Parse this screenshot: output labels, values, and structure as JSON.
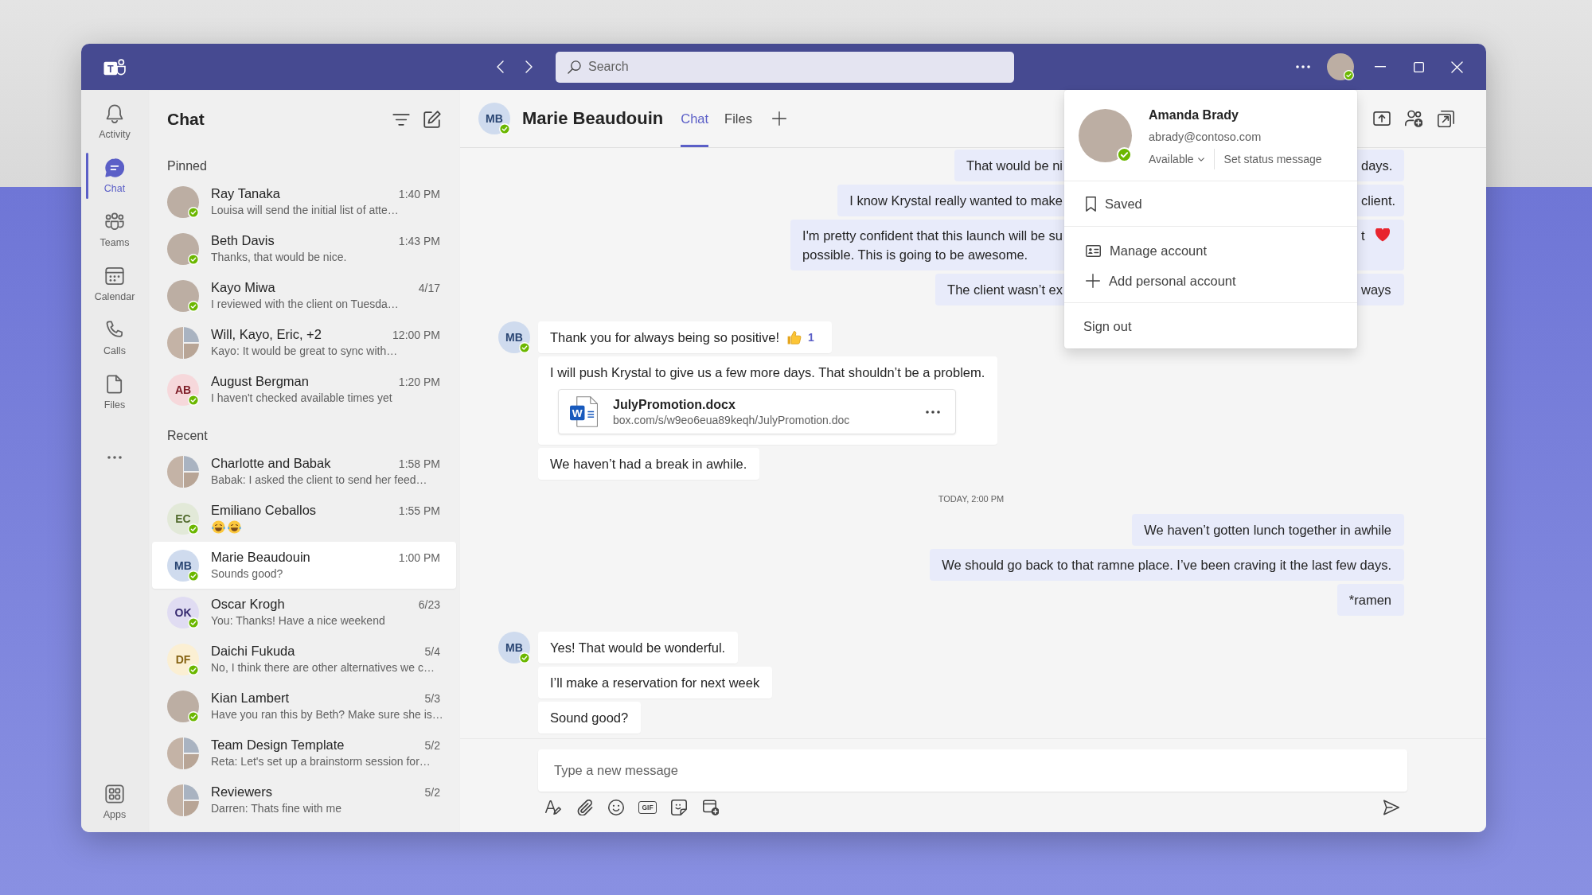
{
  "title_bar": {
    "logo_letter": "T",
    "search": {
      "placeholder": "Search"
    },
    "profile": {
      "avatar": {
        "kind": "photo"
      },
      "available": true
    }
  },
  "rail": {
    "items": [
      {
        "label": "Activity",
        "selected": false
      },
      {
        "label": "Chat",
        "selected": true
      },
      {
        "label": "Teams",
        "selected": false
      },
      {
        "label": "Calendar",
        "selected": false
      },
      {
        "label": "Calls",
        "selected": false
      },
      {
        "label": "Files",
        "selected": false
      }
    ],
    "bottom_items": [
      {
        "label": "Apps",
        "selected": false
      }
    ]
  },
  "chat_list": {
    "title": "Chat",
    "sections": [
      {
        "label": "Pinned",
        "chats": [
          {
            "name": "Ray Tanaka",
            "time": "1:40 PM",
            "kind": "text",
            "preview": "Louisa will send the initial list of atte…",
            "avatar": {
              "kind": "photo"
            },
            "available": true,
            "selected": false
          },
          {
            "name": "Beth Davis",
            "time": "1:43 PM",
            "kind": "text",
            "preview": "Thanks, that would be nice.",
            "avatar": {
              "kind": "photo"
            },
            "available": true,
            "selected": false
          },
          {
            "name": "Kayo Miwa",
            "time": "4/17",
            "kind": "text",
            "preview": "I reviewed with the client on Tuesda…",
            "avatar": {
              "kind": "photo"
            },
            "available": true,
            "selected": false
          },
          {
            "name": "Will, Kayo, Eric, +2",
            "time": "12:00 PM",
            "kind": "text",
            "preview": "Kayo: It would be great to sync with…",
            "avatar": {
              "kind": "group"
            },
            "available": false,
            "selected": false
          },
          {
            "name": "August Bergman",
            "time": "1:20 PM",
            "kind": "text",
            "preview": "I haven't checked available times yet",
            "avatar": {
              "kind": "initials",
              "initials": "AB",
              "color": "#f6d8db"
            },
            "available": true,
            "selected": false
          }
        ]
      },
      {
        "label": "Recent",
        "chats": [
          {
            "name": "Charlotte and Babak",
            "time": "1:58 PM",
            "kind": "text",
            "preview": "Babak: I asked the client to send her feed…",
            "avatar": {
              "kind": "group"
            },
            "available": false,
            "selected": false
          },
          {
            "name": "Emiliano Ceballos",
            "time": "1:55 PM",
            "kind": "emoji",
            "avatar": {
              "kind": "initials",
              "initials": "EC",
              "color": "#e2e9d8"
            },
            "available": true,
            "selected": false
          },
          {
            "name": "Marie Beaudouin",
            "time": "1:00 PM",
            "kind": "text",
            "preview": "Sounds good?",
            "avatar": {
              "kind": "initials",
              "initials": "MB",
              "color": "#cfdbee"
            },
            "available": true,
            "selected": true
          },
          {
            "name": "Oscar Krogh",
            "time": "6/23",
            "kind": "text",
            "preview": "You: Thanks! Have a nice weekend",
            "avatar": {
              "kind": "initials",
              "initials": "OK",
              "color": "#e0dcf2"
            },
            "available": true,
            "selected": false
          },
          {
            "name": "Daichi Fukuda",
            "time": "5/4",
            "kind": "text",
            "preview": "No, I think there are other alternatives we c…",
            "avatar": {
              "kind": "initials",
              "initials": "DF",
              "color": "#fbefd3"
            },
            "available": true,
            "selected": false
          },
          {
            "name": "Kian Lambert",
            "time": "5/3",
            "kind": "text",
            "preview": "Have you ran this by Beth? Make sure she is…",
            "avatar": {
              "kind": "photo"
            },
            "available": true,
            "selected": false
          },
          {
            "name": "Team Design Template",
            "time": "5/2",
            "kind": "text",
            "preview": "Reta: Let's set up a brainstorm session for…",
            "avatar": {
              "kind": "group"
            },
            "available": false,
            "selected": false
          },
          {
            "name": "Reviewers",
            "time": "5/2",
            "kind": "text",
            "preview": "Darren: Thats fine with me",
            "avatar": {
              "kind": "group"
            },
            "available": false,
            "selected": false
          }
        ]
      }
    ]
  },
  "conversation": {
    "header": {
      "avatar": {
        "kind": "initials",
        "initials": "MB",
        "color": "#cfdbee"
      },
      "available": true,
      "name": "Marie Beaudouin",
      "tabs": [
        {
          "label": "Chat",
          "selected": true
        },
        {
          "label": "Files",
          "selected": false
        }
      ]
    },
    "messages": [
      {
        "kind": "outgoing",
        "bubbles": [
          {
            "kind": "split",
            "left_lines": [
              "That would be ni"
            ],
            "right_text": "days."
          },
          {
            "kind": "split",
            "left_lines": [
              "I know Krystal really wanted to make"
            ],
            "right_text": "client."
          },
          {
            "kind": "split",
            "left_lines": [
              "I'm pretty confident that this launch will be su",
              "possible. This is going to be awesome."
            ],
            "right_text": "t",
            "reaction": {
              "kind": "heart"
            }
          },
          {
            "kind": "split",
            "left_lines": [
              "The client wasn’t ex"
            ],
            "right_text": "ways"
          }
        ]
      },
      {
        "kind": "incoming",
        "avatar": {
          "kind": "initials",
          "initials": "MB",
          "color": "#cfdbee"
        },
        "available": true,
        "bubbles": [
          {
            "kind": "text",
            "text": "Thank you for always being so positive!",
            "reaction": {
              "kind": "like",
              "count": "1"
            }
          },
          {
            "kind": "text",
            "text": "I will push Krystal to give us a few more days. That shouldn’t be a problem.",
            "attachment": {
              "icon_letter": "W",
              "name": "JulyPromotion.docx",
              "url": "box.com/s/w9eo6eua89keqh/JulyPromotion.doc"
            }
          },
          {
            "kind": "text",
            "text": "We haven’t had a break in awhile."
          }
        ]
      },
      {
        "kind": "timestamp",
        "text": "TODAY, 2:00 PM"
      },
      {
        "kind": "outgoing",
        "bubbles": [
          {
            "kind": "text",
            "text": "We haven’t gotten lunch together in awhile"
          },
          {
            "kind": "text",
            "text": "We should go back to that ramne place. I’ve been craving it the last few days."
          },
          {
            "kind": "text",
            "text": "*ramen"
          }
        ]
      },
      {
        "kind": "incoming",
        "avatar": {
          "kind": "initials",
          "initials": "MB",
          "color": "#cfdbee"
        },
        "available": true,
        "bubbles": [
          {
            "kind": "text",
            "text": "Yes! That would be wonderful."
          },
          {
            "kind": "text",
            "text": "I’ll make a reservation for next week"
          },
          {
            "kind": "text",
            "text": "Sound good?"
          }
        ]
      }
    ],
    "composer": {
      "placeholder": "Type a new message",
      "gif_label": "GIF"
    }
  },
  "account_menu": {
    "avatar": {
      "kind": "photo"
    },
    "available": true,
    "name": "Amanda Brady",
    "email": "abrady@contoso.com",
    "status_label": "Available",
    "status_message_link": "Set status message",
    "sections": [
      {
        "items": [
          {
            "label": "Saved"
          }
        ]
      },
      {
        "items": [
          {
            "label": "Manage account"
          },
          {
            "label": "Add personal account"
          }
        ]
      },
      {
        "items": [
          {
            "label": "Sign out"
          }
        ]
      }
    ]
  }
}
